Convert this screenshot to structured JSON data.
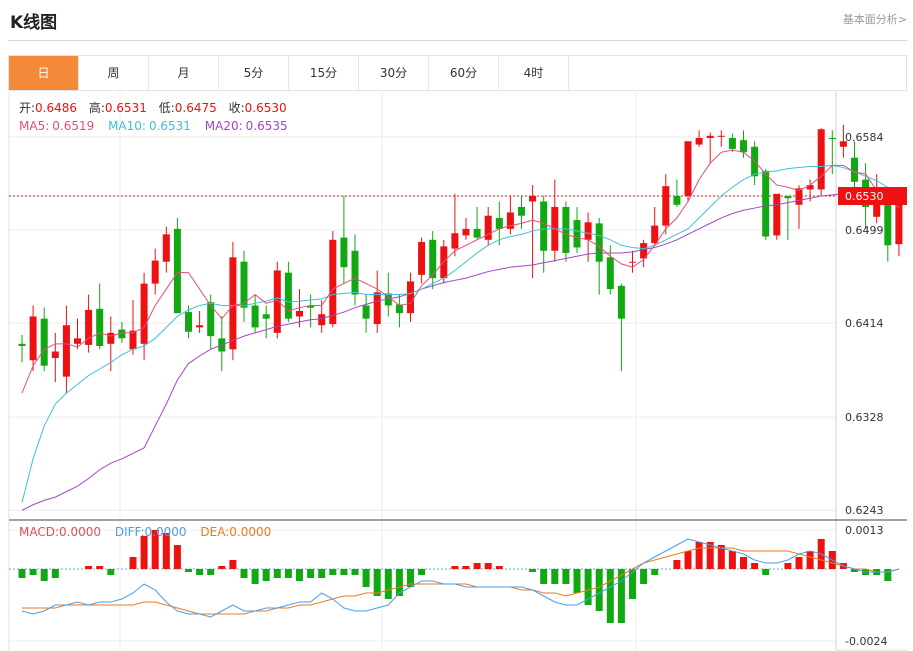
{
  "header": {
    "title": "K线图",
    "link": "基本面分析>"
  },
  "tabs": [
    {
      "label": "日",
      "active": true
    },
    {
      "label": "周",
      "active": false
    },
    {
      "label": "月",
      "active": false
    },
    {
      "label": "5分",
      "active": false
    },
    {
      "label": "15分",
      "active": false
    },
    {
      "label": "30分",
      "active": false
    },
    {
      "label": "60分",
      "active": false
    },
    {
      "label": "4时",
      "active": false
    }
  ],
  "info": {
    "open_label": "开:",
    "open": "0.6486",
    "high_label": "高:",
    "high": "0.6531",
    "low_label": "低:",
    "low": "0.6475",
    "close_label": "收:",
    "close": "0.6530",
    "ma5_label": "MA5:",
    "ma5": "0.6519",
    "ma10_label": "MA10:",
    "ma10": "0.6531",
    "ma20_label": "MA20:",
    "ma20": "0.6535",
    "macd_label": "MACD:",
    "macd": "0.0000",
    "diff_label": "DIFF:",
    "diff": "0.0000",
    "dea_label": "DEA:",
    "dea": "0.0000"
  },
  "colors": {
    "up": "#ee1111",
    "down": "#11a811",
    "ma5": "#e24f7c",
    "ma10": "#3fc1d9",
    "ma20": "#a347c1",
    "diff": "#4a9fe8",
    "dea": "#f07a1a",
    "tab_active": "#f5893a"
  },
  "chart_data": {
    "type": "candlestick",
    "ylim": [
      0.6235,
      0.6625
    ],
    "y_ticks": [
      "0.6584",
      "0.6499",
      "0.6414",
      "0.6328",
      "0.6243"
    ],
    "last_price_label": "0.6530",
    "last_price": 0.653,
    "macd_ylim": [
      -0.0027,
      0.0016
    ],
    "macd_ticks": [
      "0.0013",
      "-0.0024"
    ],
    "candles": [
      [
        0.6395,
        0.6403,
        0.6378,
        0.6393
      ],
      [
        0.638,
        0.643,
        0.637,
        0.642
      ],
      [
        0.6418,
        0.6428,
        0.637,
        0.6375
      ],
      [
        0.6382,
        0.6405,
        0.636,
        0.6388
      ],
      [
        0.6365,
        0.643,
        0.635,
        0.6412
      ],
      [
        0.6395,
        0.6418,
        0.639,
        0.64
      ],
      [
        0.6394,
        0.644,
        0.6387,
        0.6426
      ],
      [
        0.6427,
        0.645,
        0.639,
        0.6393
      ],
      [
        0.6395,
        0.642,
        0.637,
        0.6405
      ],
      [
        0.6408,
        0.6415,
        0.6396,
        0.64
      ],
      [
        0.639,
        0.6435,
        0.6385,
        0.6407
      ],
      [
        0.6395,
        0.646,
        0.638,
        0.645
      ],
      [
        0.645,
        0.6482,
        0.644,
        0.6471
      ],
      [
        0.647,
        0.6502,
        0.646,
        0.6495
      ],
      [
        0.65,
        0.651,
        0.644,
        0.6423
      ],
      [
        0.6424,
        0.643,
        0.64,
        0.6406
      ],
      [
        0.641,
        0.6425,
        0.6405,
        0.6412
      ],
      [
        0.6433,
        0.644,
        0.639,
        0.6402
      ],
      [
        0.64,
        0.642,
        0.637,
        0.6388
      ],
      [
        0.639,
        0.6488,
        0.638,
        0.6474
      ],
      [
        0.647,
        0.648,
        0.6415,
        0.6428
      ],
      [
        0.643,
        0.644,
        0.6405,
        0.641
      ],
      [
        0.6422,
        0.643,
        0.64,
        0.6418
      ],
      [
        0.6405,
        0.647,
        0.64,
        0.6462
      ],
      [
        0.646,
        0.647,
        0.6415,
        0.6418
      ],
      [
        0.642,
        0.6445,
        0.641,
        0.6425
      ],
      [
        0.643,
        0.644,
        0.641,
        0.6428
      ],
      [
        0.6412,
        0.6435,
        0.6405,
        0.6422
      ],
      [
        0.6413,
        0.6498,
        0.641,
        0.649
      ],
      [
        0.6492,
        0.653,
        0.645,
        0.6465
      ],
      [
        0.648,
        0.6495,
        0.643,
        0.644
      ],
      [
        0.643,
        0.644,
        0.6405,
        0.6418
      ],
      [
        0.6413,
        0.6462,
        0.6405,
        0.6442
      ],
      [
        0.6441,
        0.646,
        0.642,
        0.643
      ],
      [
        0.6431,
        0.644,
        0.641,
        0.6423
      ],
      [
        0.6423,
        0.646,
        0.6415,
        0.6452
      ],
      [
        0.6458,
        0.6492,
        0.645,
        0.6488
      ],
      [
        0.649,
        0.6498,
        0.6445,
        0.6455
      ],
      [
        0.6455,
        0.649,
        0.645,
        0.6484
      ],
      [
        0.6482,
        0.6532,
        0.6475,
        0.6496
      ],
      [
        0.6494,
        0.651,
        0.649,
        0.65
      ],
      [
        0.65,
        0.652,
        0.649,
        0.6492
      ],
      [
        0.649,
        0.652,
        0.6485,
        0.6512
      ],
      [
        0.651,
        0.6525,
        0.6485,
        0.65
      ],
      [
        0.65,
        0.653,
        0.6495,
        0.6515
      ],
      [
        0.652,
        0.653,
        0.65,
        0.6512
      ],
      [
        0.6525,
        0.654,
        0.6455,
        0.653
      ],
      [
        0.6525,
        0.653,
        0.646,
        0.648
      ],
      [
        0.648,
        0.6545,
        0.647,
        0.652
      ],
      [
        0.652,
        0.6525,
        0.647,
        0.6478
      ],
      [
        0.6508,
        0.652,
        0.6478,
        0.6483
      ],
      [
        0.649,
        0.6515,
        0.647,
        0.6506
      ],
      [
        0.6505,
        0.651,
        0.644,
        0.647
      ],
      [
        0.6474,
        0.6485,
        0.644,
        0.6445
      ],
      [
        0.6448,
        0.645,
        0.637,
        0.6418
      ],
      [
        0.647,
        0.648,
        0.646,
        0.647
      ],
      [
        0.6473,
        0.649,
        0.6465,
        0.6487
      ],
      [
        0.6487,
        0.652,
        0.6485,
        0.6503
      ],
      [
        0.6503,
        0.655,
        0.6495,
        0.6539
      ],
      [
        0.653,
        0.6545,
        0.652,
        0.6522
      ],
      [
        0.653,
        0.658,
        0.6525,
        0.658
      ],
      [
        0.6577,
        0.659,
        0.6575,
        0.6583
      ],
      [
        0.6583,
        0.6588,
        0.656,
        0.6585
      ],
      [
        0.6585,
        0.659,
        0.6575,
        0.6585
      ],
      [
        0.6583,
        0.6587,
        0.657,
        0.6573
      ],
      [
        0.6581,
        0.659,
        0.6565,
        0.657
      ],
      [
        0.6575,
        0.658,
        0.654,
        0.6548
      ],
      [
        0.6553,
        0.6555,
        0.649,
        0.6493
      ],
      [
        0.6494,
        0.6498,
        0.649,
        0.6532
      ],
      [
        0.653,
        0.653,
        0.649,
        0.6528
      ],
      [
        0.6522,
        0.654,
        0.65,
        0.6537
      ],
      [
        0.6536,
        0.6545,
        0.6525,
        0.654
      ],
      [
        0.6536,
        0.6592,
        0.653,
        0.6591
      ],
      [
        0.6583,
        0.659,
        0.655,
        0.6582
      ],
      [
        0.6575,
        0.6595,
        0.6565,
        0.658
      ],
      [
        0.6565,
        0.658,
        0.6538,
        0.6543
      ],
      [
        0.6545,
        0.656,
        0.65,
        0.652
      ],
      [
        0.6511,
        0.655,
        0.6505,
        0.6527
      ],
      [
        0.6525,
        0.653,
        0.647,
        0.6485
      ],
      [
        0.6486,
        0.6531,
        0.6475,
        0.653
      ]
    ],
    "ma5": [
      0.635,
      0.6375,
      0.639,
      0.6395,
      0.6395,
      0.6392,
      0.64,
      0.6405,
      0.6402,
      0.6405,
      0.6405,
      0.641,
      0.643,
      0.6445,
      0.646,
      0.646,
      0.6445,
      0.643,
      0.6418,
      0.643,
      0.6432,
      0.644,
      0.6432,
      0.6435,
      0.6425,
      0.6428,
      0.643,
      0.643,
      0.6445,
      0.645,
      0.6455,
      0.645,
      0.6445,
      0.6438,
      0.643,
      0.6432,
      0.6448,
      0.6458,
      0.647,
      0.648,
      0.6485,
      0.649,
      0.6495,
      0.65,
      0.6503,
      0.6505,
      0.6508,
      0.6505,
      0.65,
      0.6495,
      0.6492,
      0.649,
      0.6484,
      0.6475,
      0.6468,
      0.6465,
      0.6472,
      0.6485,
      0.65,
      0.651,
      0.6525,
      0.6545,
      0.656,
      0.657,
      0.6572,
      0.657,
      0.6562,
      0.655,
      0.654,
      0.6538,
      0.6535,
      0.654,
      0.6548,
      0.6558,
      0.6558,
      0.6552,
      0.655,
      0.6535,
      0.6528,
      0.6519
    ],
    "ma10": [
      0.625,
      0.629,
      0.632,
      0.634,
      0.635,
      0.6358,
      0.6366,
      0.6372,
      0.6378,
      0.6385,
      0.639,
      0.6393,
      0.64,
      0.641,
      0.642,
      0.6426,
      0.643,
      0.6432,
      0.643,
      0.643,
      0.643,
      0.6432,
      0.6434,
      0.6437,
      0.6433,
      0.6434,
      0.6435,
      0.6436,
      0.644,
      0.6441,
      0.6442,
      0.644,
      0.644,
      0.644,
      0.644,
      0.6441,
      0.6445,
      0.645,
      0.6455,
      0.6462,
      0.647,
      0.6478,
      0.6485,
      0.649,
      0.6493,
      0.6495,
      0.6498,
      0.65,
      0.65,
      0.65,
      0.6498,
      0.6496,
      0.6494,
      0.649,
      0.6485,
      0.6483,
      0.6482,
      0.6485,
      0.649,
      0.6495,
      0.65,
      0.651,
      0.652,
      0.653,
      0.6538,
      0.6545,
      0.655,
      0.6552,
      0.6553,
      0.6555,
      0.6556,
      0.6557,
      0.6557,
      0.6558,
      0.6556,
      0.6552,
      0.6548,
      0.6544,
      0.6538,
      0.6531
    ],
    "ma20": [
      0.6243,
      0.6248,
      0.6252,
      0.6255,
      0.626,
      0.6265,
      0.6272,
      0.628,
      0.6286,
      0.629,
      0.6295,
      0.63,
      0.632,
      0.634,
      0.6362,
      0.6377,
      0.6384,
      0.639,
      0.6394,
      0.6398,
      0.6402,
      0.6405,
      0.6408,
      0.6411,
      0.6413,
      0.6415,
      0.6417,
      0.6418,
      0.6421,
      0.6424,
      0.6428,
      0.6431,
      0.6434,
      0.6436,
      0.6438,
      0.6441,
      0.6445,
      0.6448,
      0.6451,
      0.6453,
      0.6455,
      0.6458,
      0.6461,
      0.6463,
      0.6465,
      0.6466,
      0.6467,
      0.6469,
      0.6471,
      0.6473,
      0.6475,
      0.6477,
      0.6478,
      0.6478,
      0.6478,
      0.6479,
      0.6481,
      0.6483,
      0.6486,
      0.649,
      0.6495,
      0.65,
      0.6505,
      0.651,
      0.6514,
      0.6517,
      0.6519,
      0.6521,
      0.6522,
      0.6524,
      0.6526,
      0.6528,
      0.653,
      0.6531,
      0.6532,
      0.6532,
      0.6533,
      0.6534,
      0.6534,
      0.6535
    ],
    "macd": [
      -0.0003,
      -0.0002,
      -0.0004,
      -0.0003,
      0.0,
      0.0,
      0.0001,
      0.0001,
      -0.0002,
      0.0,
      0.0004,
      0.0011,
      0.0013,
      0.0012,
      0.0008,
      -0.0001,
      -0.0002,
      -0.0002,
      0.0001,
      0.0003,
      -0.0003,
      -0.0005,
      -0.0004,
      -0.0003,
      -0.0003,
      -0.0004,
      -0.0003,
      -0.0003,
      -0.0002,
      -0.0002,
      -0.0002,
      -0.0006,
      -0.0009,
      -0.001,
      -0.0009,
      -0.0006,
      -0.0002,
      0.0,
      0.0,
      0.0001,
      0.0001,
      0.0002,
      0.0002,
      0.0001,
      0.0,
      0.0,
      -0.0001,
      -0.0005,
      -0.0005,
      -0.0005,
      -0.0008,
      -0.0012,
      -0.0014,
      -0.0018,
      -0.0018,
      -0.001,
      -0.0005,
      -0.0002,
      0.0,
      0.0003,
      0.0006,
      0.0009,
      0.0009,
      0.0008,
      0.0006,
      0.0004,
      0.0002,
      -0.0002,
      0.0,
      0.0002,
      0.0004,
      0.0006,
      0.001,
      0.0006,
      0.0002,
      -0.0001,
      -0.0002,
      -0.0002,
      -0.0004,
      0.0
    ],
    "diff": [
      -0.0014,
      -0.0015,
      -0.0014,
      -0.0012,
      -0.0012,
      -0.0011,
      -0.0012,
      -0.0011,
      -0.0011,
      -0.001,
      -0.0008,
      -0.0005,
      -0.0007,
      -0.0011,
      -0.0014,
      -0.0015,
      -0.0015,
      -0.0016,
      -0.0014,
      -0.0012,
      -0.0014,
      -0.0014,
      -0.0013,
      -0.0013,
      -0.0012,
      -0.0011,
      -0.0011,
      -0.0008,
      -0.001,
      -0.0013,
      -0.0014,
      -0.0014,
      -0.0013,
      -0.0012,
      -0.0008,
      -0.0006,
      -0.0004,
      -0.0004,
      -0.0005,
      -0.0005,
      -0.0006,
      -0.0006,
      -0.0006,
      -0.0006,
      -0.0006,
      -0.0006,
      -0.0007,
      -0.0009,
      -0.0011,
      -0.0012,
      -0.0012,
      -0.001,
      -0.0008,
      -0.0006,
      -0.0004,
      -0.0001,
      0.0002,
      0.0004,
      0.0006,
      0.0008,
      0.001,
      0.0009,
      0.0008,
      0.0007,
      0.0006,
      0.0005,
      0.0003,
      0.0002,
      0.0002,
      0.0003,
      0.0005,
      0.0006,
      0.0005,
      0.0003,
      0.0001,
      0.0,
      -0.0001,
      -0.0001,
      -0.0001,
      0.0
    ],
    "dea": [
      -0.0013,
      -0.0013,
      -0.0013,
      -0.0013,
      -0.0012,
      -0.0012,
      -0.0012,
      -0.0012,
      -0.0012,
      -0.0012,
      -0.0012,
      -0.0011,
      -0.0011,
      -0.0012,
      -0.0013,
      -0.0014,
      -0.0015,
      -0.0015,
      -0.0015,
      -0.0015,
      -0.0015,
      -0.0014,
      -0.0014,
      -0.0013,
      -0.0013,
      -0.0012,
      -0.0012,
      -0.0011,
      -0.001,
      -0.0009,
      -0.0009,
      -0.0008,
      -0.0008,
      -0.0007,
      -0.0006,
      -0.0005,
      -0.0005,
      -0.0005,
      -0.0005,
      -0.0005,
      -0.0005,
      -0.0006,
      -0.0006,
      -0.0006,
      -0.0006,
      -0.0007,
      -0.0007,
      -0.0008,
      -0.0008,
      -0.0009,
      -0.0008,
      -0.0007,
      -0.0006,
      -0.0004,
      -0.0002,
      0.0,
      0.0002,
      0.0003,
      0.0004,
      0.0005,
      0.0006,
      0.0007,
      0.0007,
      0.0007,
      0.0007,
      0.0006,
      0.0006,
      0.0006,
      0.0006,
      0.0006,
      0.0005,
      0.0004,
      0.0003,
      0.0002,
      0.0001,
      0.0,
      0.0,
      -0.0001,
      -0.0001,
      0.0
    ]
  }
}
